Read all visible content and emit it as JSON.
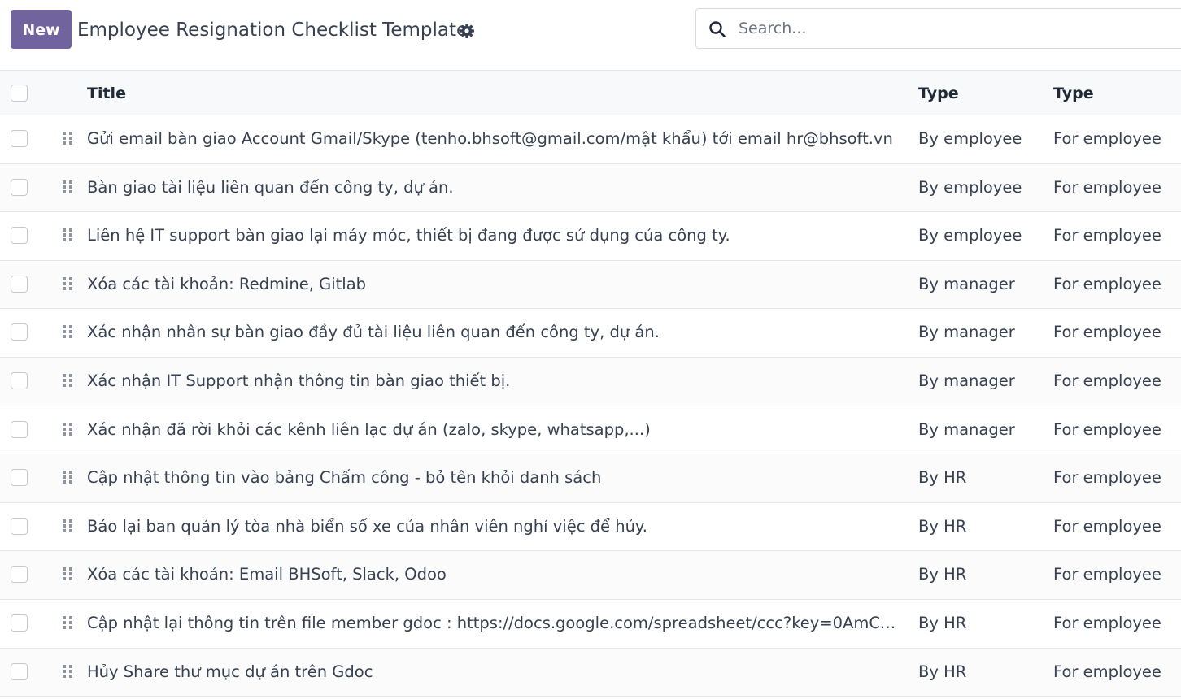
{
  "header": {
    "new_label": "New",
    "title": "Employee Resignation Checklist Template",
    "search_placeholder": "Search..."
  },
  "table": {
    "columns": [
      "Title",
      "Type",
      "Type"
    ],
    "rows": [
      {
        "title": "Gửi email bàn giao Account Gmail/Skype (tenho.bhsoft@gmail.com/mật khẩu) tới email hr@bhsoft.vn",
        "type": "By employee",
        "type2": "For employee"
      },
      {
        "title": "Bàn giao tài liệu liên quan đến công ty, dự án.",
        "type": "By employee",
        "type2": "For employee"
      },
      {
        "title": "Liên hệ IT support bàn giao lại máy móc, thiết bị đang được sử dụng của công ty.",
        "type": "By employee",
        "type2": "For employee"
      },
      {
        "title": "Xóa các tài khoản: Redmine, Gitlab",
        "type": "By manager",
        "type2": "For employee"
      },
      {
        "title": "Xác nhận nhân sự bàn giao đầy đủ tài liệu liên quan đến công ty, dự án.",
        "type": "By manager",
        "type2": "For employee"
      },
      {
        "title": "Xác nhận IT Support nhận thông tin bàn giao thiết bị.",
        "type": "By manager",
        "type2": "For employee"
      },
      {
        "title": "Xác nhận đã rời khỏi các kênh liên lạc dự án (zalo, skype, whatsapp,...)",
        "type": "By manager",
        "type2": "For employee"
      },
      {
        "title": "Cập nhật thông tin vào bảng Chấm công - bỏ tên khỏi danh sách",
        "type": "By HR",
        "type2": "For employee"
      },
      {
        "title": "Báo lại ban quản lý tòa nhà biển số xe của nhân viên nghỉ việc để hủy.",
        "type": "By HR",
        "type2": "For employee"
      },
      {
        "title": "Xóa các tài khoản: Email BHSoft, Slack, Odoo",
        "type": "By HR",
        "type2": "For employee"
      },
      {
        "title": "Cập nhật lại thông tin trên file member gdoc : https://docs.google.com/spreadsheet/ccc?key=0AmCY5X8s...",
        "type": "By HR",
        "type2": "For employee"
      },
      {
        "title": "Hủy Share thư mục dự án trên Gdoc",
        "type": "By HR",
        "type2": "For employee"
      }
    ]
  },
  "icons": {
    "settings": "gear-icon",
    "search": "search-icon",
    "drag": "drag-handle-icon"
  },
  "colors": {
    "primary": "#71639e",
    "header_bg": "#f8f9fa",
    "border": "#e4e6e9"
  }
}
